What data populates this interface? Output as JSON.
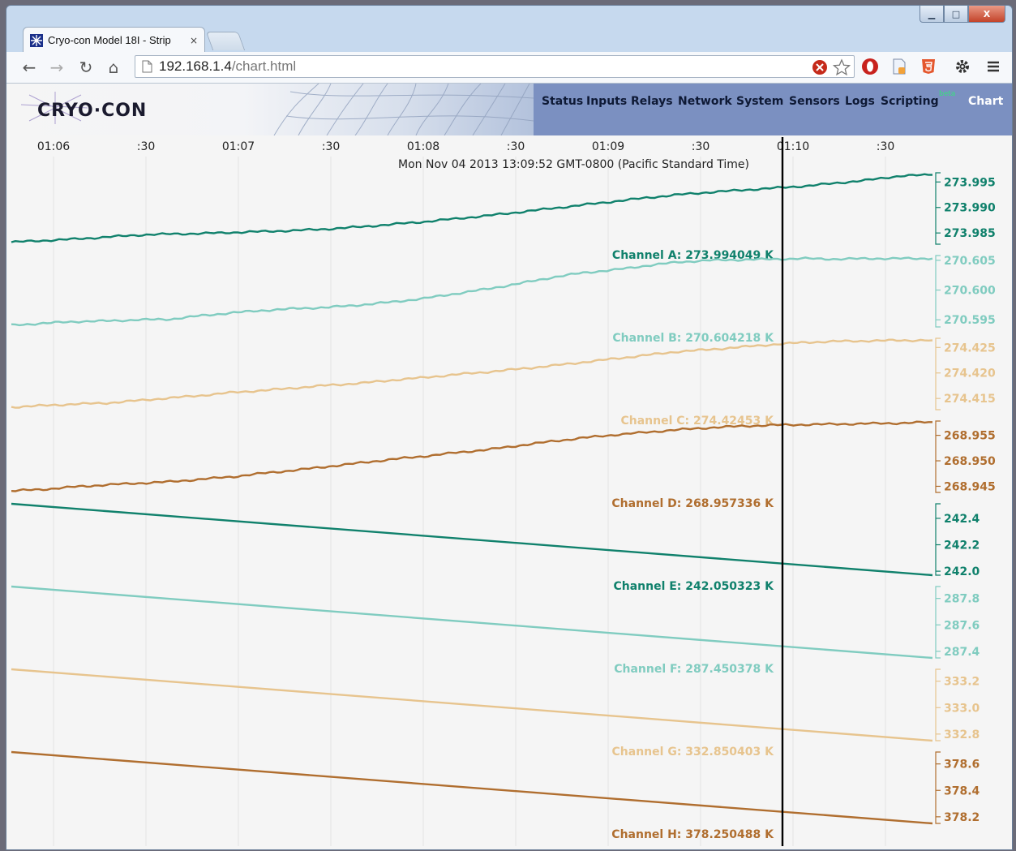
{
  "browser": {
    "tab_title": "Cryo-con Model 18I - Strip",
    "tab_close": "×",
    "url_host": "192.168.1.4",
    "url_path": "/chart.html",
    "window_buttons": {
      "minimize": "▁",
      "maximize": "□",
      "close": "X"
    },
    "icons": [
      "back-icon",
      "forward-icon",
      "reload-icon",
      "home-icon",
      "page-icon",
      "error-icon",
      "star-icon",
      "opera-icon",
      "note-icon",
      "html5-icon",
      "gear-icon",
      "menu-icon"
    ]
  },
  "app": {
    "logo_text": "CRYO·CON",
    "nav": [
      "Status",
      "Inputs",
      "Relays",
      "Network",
      "System",
      "Sensors",
      "Logs",
      "Scripting"
    ],
    "beta": "beta",
    "active": "Chart"
  },
  "chart_data": {
    "type": "line",
    "timestamp": "Mon Nov 04 2013 13:09:52 GMT-0800 (Pacific Standard Time)",
    "time_ticks": [
      "01:06",
      ":30",
      "01:07",
      ":30",
      "01:08",
      ":30",
      "01:09",
      ":30",
      "01:10",
      ":30"
    ],
    "cursor_time": "13:09:52",
    "series": [
      {
        "name": "Channel A",
        "readout": "Channel A: 273.994049 K",
        "color": "#10816c",
        "ticks": [
          "273.995",
          "273.990",
          "273.985"
        ],
        "ylim": [
          273.9828,
          273.9968
        ],
        "values": [
          273.9832,
          273.9835,
          273.9838,
          273.9842,
          273.9846,
          273.9848,
          273.9849,
          273.9851,
          273.9853,
          273.9855,
          273.9858,
          273.9862,
          273.9867,
          273.9872,
          273.9878,
          273.9884,
          273.9891,
          273.9898,
          273.9905,
          273.9912,
          273.9919,
          273.9925,
          273.993,
          273.9934,
          273.9938,
          273.9942,
          273.9948,
          273.9954,
          273.9962,
          273.9964
        ]
      },
      {
        "name": "Channel B",
        "readout": "Channel B: 270.604218 K",
        "color": "#80ccc0",
        "ticks": [
          "270.605",
          "270.600",
          "270.595"
        ],
        "ylim": [
          270.5938,
          270.6058
        ],
        "values": [
          270.5941,
          270.5944,
          270.5947,
          270.5948,
          270.595,
          270.5951,
          270.5957,
          270.5962,
          270.5966,
          270.5969,
          270.5971,
          270.5975,
          270.598,
          270.5986,
          270.5994,
          270.6002,
          270.6011,
          270.6021,
          270.6029,
          270.6034,
          270.6041,
          270.6047,
          270.605,
          270.6051,
          270.6052,
          270.6053,
          270.6052,
          270.6053,
          270.6053,
          270.6053
        ]
      },
      {
        "name": "Channel C",
        "readout": "Channel C: 274.42453 K",
        "color": "#e7c48e",
        "ticks": [
          "274.425",
          "274.420",
          "274.415"
        ],
        "ylim": [
          274.4128,
          274.4268
        ],
        "values": [
          274.4133,
          274.4136,
          274.4139,
          274.4141,
          274.4146,
          274.4151,
          274.4156,
          274.4162,
          274.4166,
          274.4171,
          274.4176,
          274.418,
          274.4186,
          274.4191,
          274.4197,
          274.4202,
          274.4208,
          274.4214,
          274.4221,
          274.4228,
          274.4235,
          274.4242,
          274.4246,
          274.4251,
          274.4256,
          274.426,
          274.4262,
          274.4263,
          274.4264,
          274.4264
        ]
      },
      {
        "name": "Channel D",
        "readout": "Channel D: 268.957336 K",
        "color": "#b06e2f",
        "ticks": [
          "268.955",
          "268.950",
          "268.945"
        ],
        "ylim": [
          268.9438,
          268.9578
        ],
        "values": [
          268.9441,
          268.9444,
          268.9449,
          268.9453,
          268.9456,
          268.9459,
          268.9464,
          268.9469,
          268.9476,
          268.9482,
          268.9489,
          268.9496,
          268.9503,
          268.9509,
          268.9516,
          268.9522,
          268.953,
          268.9538,
          268.9545,
          268.9551,
          268.9556,
          268.9561,
          268.9565,
          268.9568,
          268.957,
          268.9571,
          268.9572,
          268.9573,
          268.9574,
          268.9576
        ]
      },
      {
        "name": "Channel E",
        "readout": "Channel E: 242.050323 K",
        "color": "#10816c",
        "ticks": [
          "242.4",
          "242.2",
          "242.0"
        ],
        "ylim": [
          241.97,
          242.51
        ],
        "values": [
          242.51,
          241.97
        ]
      },
      {
        "name": "Channel F",
        "readout": "Channel F: 287.450378 K",
        "color": "#80ccc0",
        "ticks": [
          "287.8",
          "287.6",
          "287.4"
        ],
        "ylim": [
          287.35,
          287.89
        ],
        "values": [
          287.89,
          287.35
        ]
      },
      {
        "name": "Channel G",
        "readout": "Channel G: 332.850403 K",
        "color": "#e7c48e",
        "ticks": [
          "333.2",
          "333.0",
          "332.8"
        ],
        "ylim": [
          332.75,
          333.29
        ],
        "values": [
          333.29,
          332.75
        ]
      },
      {
        "name": "Channel H",
        "readout": "Channel H: 378.250488 K",
        "color": "#b06e2f",
        "ticks": [
          "378.6",
          "378.4",
          "378.2"
        ],
        "ylim": [
          378.15,
          378.69
        ],
        "values": [
          378.69,
          378.15
        ]
      }
    ]
  }
}
